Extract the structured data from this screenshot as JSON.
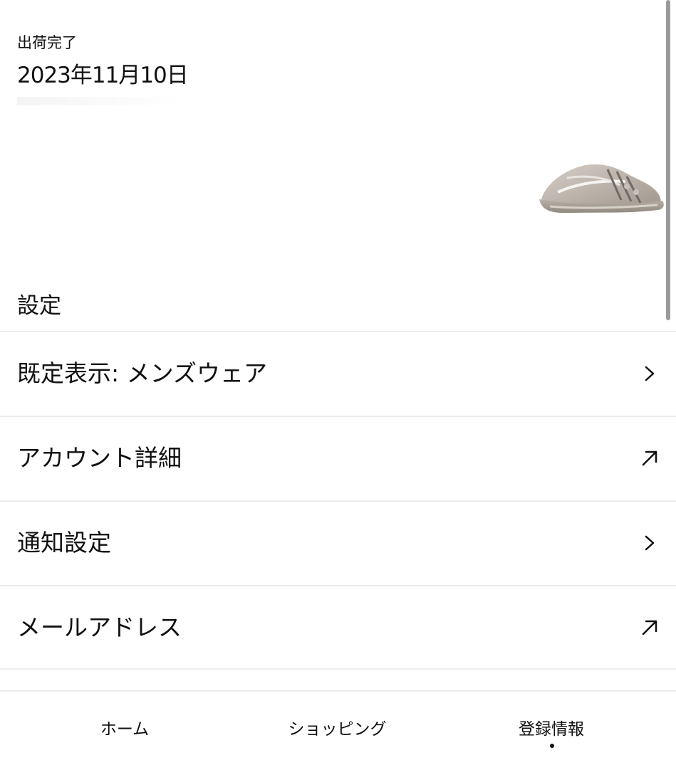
{
  "order": {
    "status": "出荷完了",
    "date": "2023年11月10日"
  },
  "settings": {
    "title": "設定",
    "items": [
      {
        "label": "既定表示: メンズウェア",
        "icon": "chevron-right-icon"
      },
      {
        "label": "アカウント詳細",
        "icon": "external-arrow-icon"
      },
      {
        "label": "通知設定",
        "icon": "chevron-right-icon"
      },
      {
        "label": "メールアドレス",
        "icon": "external-arrow-icon"
      }
    ]
  },
  "nav": {
    "home": "ホーム",
    "shopping": "ショッピング",
    "account": "登録情報",
    "active": "account"
  },
  "colors": {
    "text": "#111111",
    "divider": "#ececec",
    "scrollbar": "#9a9a9a"
  }
}
